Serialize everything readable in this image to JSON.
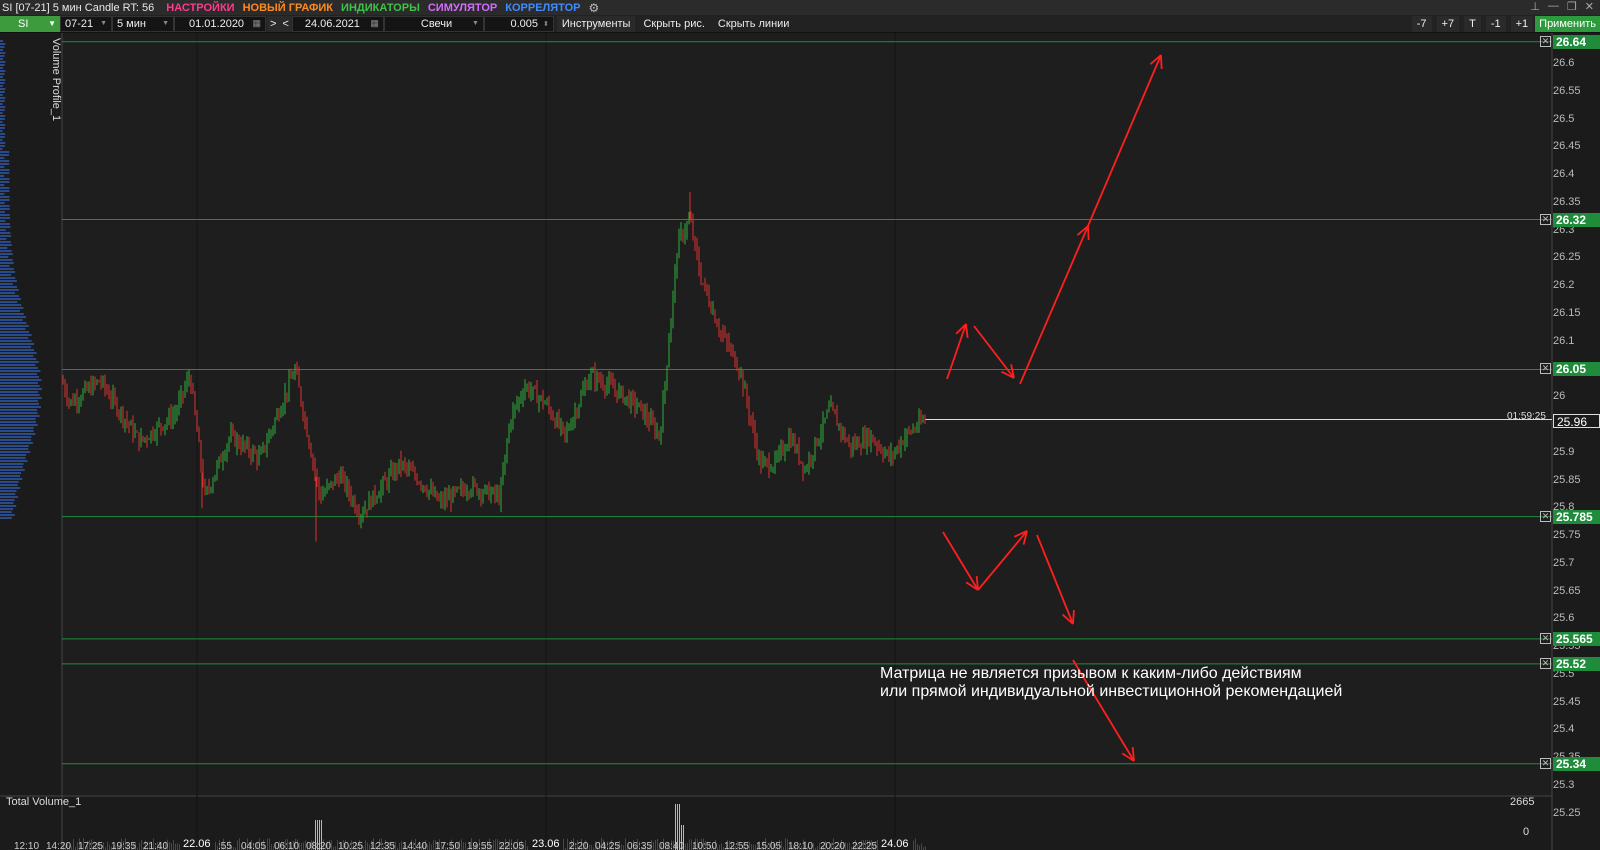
{
  "window": {
    "title": "SI [07-21] 5 мин Candle RT: 56",
    "menu": [
      {
        "label": "НАСТРОЙКИ",
        "color": "#ff3a8c"
      },
      {
        "label": "НОВЫЙ ГРАФИК",
        "color": "#ff8a1c"
      },
      {
        "label": "ИНДИКАТОРЫ",
        "color": "#3ec24a"
      },
      {
        "label": "СИМУЛЯТОР",
        "color": "#d46cff"
      },
      {
        "label": "КОРРЕЛЯТОР",
        "color": "#3f8cff"
      }
    ],
    "settings_icon": "gears-icon"
  },
  "toolbar": {
    "symbol": "SI",
    "contract": "07-21",
    "timeframe": "5 мин",
    "date_from": "01.01.2020",
    "nav_next": ">",
    "nav_prev": "<",
    "date_to": "24.06.2021",
    "chart_type": "Свечи",
    "step": "0.005",
    "instruments_btn": "Инструменты",
    "hide_drawings_btn": "Скрыть рис.",
    "hide_lines_btn": "Скрыть линии",
    "minus7": "-7",
    "plus7": "+7",
    "t_btn": "T",
    "minus1": "-1",
    "plus1": "+1",
    "apply_btn": "Применить"
  },
  "chart": {
    "volume_profile_label": "Volume Profile_1",
    "total_volume_label": "Total Volume_1",
    "total_volume_max": "2665",
    "total_volume_zero": "0",
    "timer": "01:59:25",
    "current_price": "25.96",
    "level_lines": [
      "26.64",
      "26.32",
      "26.05",
      "25.785",
      "25.565",
      "25.52",
      "25.34"
    ],
    "y_ticks": [
      "26.6",
      "26.55",
      "26.5",
      "26.45",
      "26.4",
      "26.35",
      "26.3",
      "26.25",
      "26.2",
      "26.15",
      "26.1",
      "26.05",
      "26",
      "25.95",
      "25.9",
      "25.85",
      "25.8",
      "25.75",
      "25.7",
      "25.65",
      "25.6",
      "25.55",
      "25.5",
      "25.45",
      "25.4",
      "25.35",
      "25.3",
      "25.25"
    ],
    "x_ticks": [
      "12:10",
      "14:20",
      "17:25",
      "19:35",
      "21:40",
      ":55",
      "04:05",
      "06:10",
      "08:20",
      "10:25",
      "12:35",
      "14:40",
      "17:50",
      "19:55",
      "22:05",
      "2:20",
      "04:25",
      "06:35",
      "08:40",
      "10:50",
      "12:55",
      "15:05",
      "18:10",
      "20:20",
      "22:25"
    ],
    "x_dates": [
      "22.06",
      "23.06",
      "24.06"
    ],
    "annotation_line1": "Матрица не является призывом к каким-либо действиям",
    "annotation_line2": "или прямой индивидуальной инвестиционной рекомендацией",
    "colors": {
      "up": "#2fae3c",
      "down": "#d8322f",
      "level": "#1f8c3c",
      "arrow": "#ff1f1f"
    }
  }
}
